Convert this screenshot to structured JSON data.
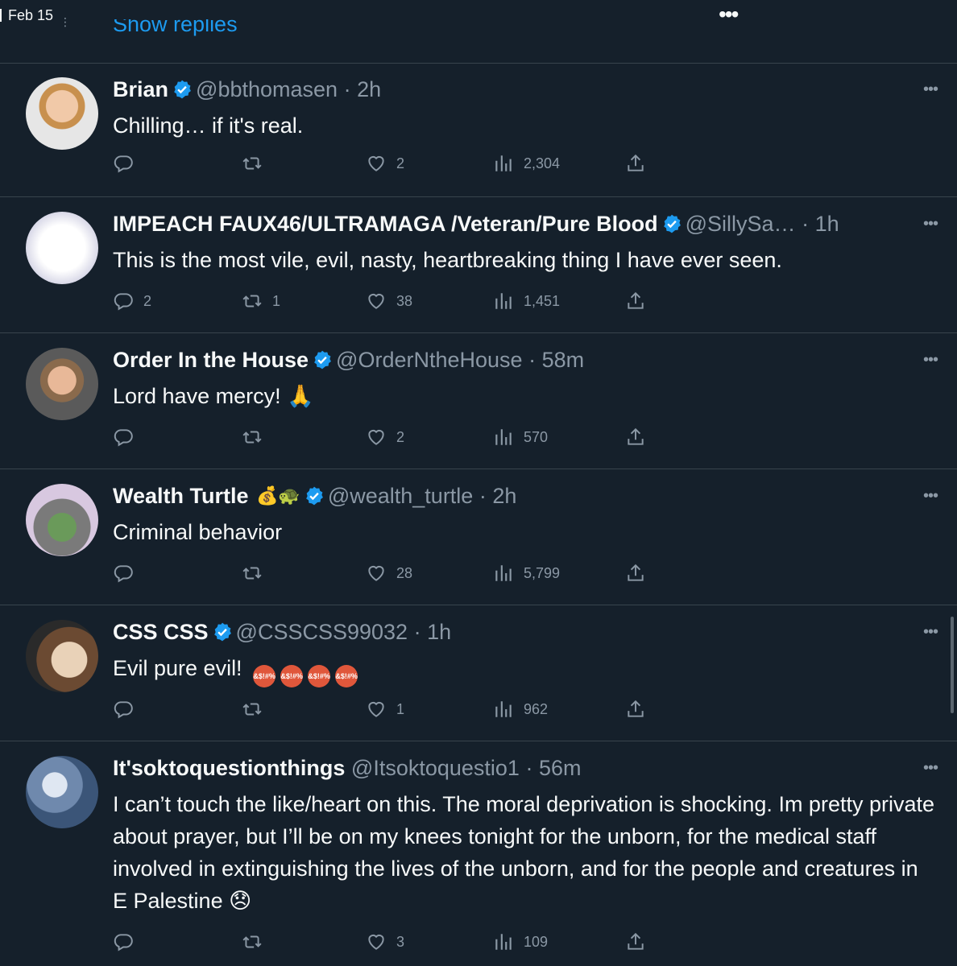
{
  "topbar": {
    "date": "Feb 15",
    "show_replies": "Show replies"
  },
  "colors": {
    "background": "#15202b",
    "accent": "#1d9bf0",
    "muted": "#8b98a5",
    "divider": "#38444d"
  },
  "tweets": [
    {
      "name": "Brian",
      "handle": "@bbthomasen",
      "time": "2h",
      "sep": "·",
      "text": "Chilling… if it's real.",
      "replies": "",
      "retweets": "",
      "likes": "2",
      "views": "2,304",
      "emoji": ""
    },
    {
      "name": "IMPEACH FAUX46/ULTRAMAGA /Veteran/Pure Blood",
      "handle": "@SillySa…",
      "time": "1h",
      "sep": "·",
      "text": "This is the most vile, evil, nasty, heartbreaking thing I have ever seen.",
      "replies": "2",
      "retweets": "1",
      "likes": "38",
      "views": "1,451",
      "emoji": ""
    },
    {
      "name": "Order In the House",
      "handle": "@OrderNtheHouse",
      "time": "58m",
      "sep": "·",
      "text": "Lord have mercy! 🙏",
      "replies": "",
      "retweets": "",
      "likes": "2",
      "views": "570",
      "emoji": ""
    },
    {
      "name": "Wealth Turtle",
      "handle": "@wealth_turtle",
      "time": "2h",
      "sep": "·",
      "text": "Criminal behavior",
      "replies": "",
      "retweets": "",
      "likes": "28",
      "views": "5,799",
      "emoji": "💰🐢"
    },
    {
      "name": "CSS CSS",
      "handle": "@CSSCSS99032",
      "time": "1h",
      "sep": "·",
      "text": "Evil pure evil!",
      "replies": "",
      "retweets": "",
      "likes": "1",
      "views": "962",
      "emoji": ""
    },
    {
      "name": "It'soktoquestionthings",
      "handle": "@Itsoktoquestio1",
      "time": "56m",
      "sep": "·",
      "text": "I can’t touch the like/heart on this. The moral deprivation is shocking. Im pretty private about prayer, but I’ll be on my knees tonight for the unborn, for the medical staff involved in extinguishing the lives of the unborn, and for the people and creatures in E Palestine 😞",
      "replies": "",
      "retweets": "",
      "likes": "3",
      "views": "109",
      "emoji": ""
    }
  ],
  "icons": {
    "more": "more-horizontal-icon",
    "verified": "verified-badge-icon",
    "reply": "reply-icon",
    "retweet": "retweet-icon",
    "like": "heart-icon",
    "views": "views-icon",
    "share": "share-icon"
  },
  "css_emoji_label": "&$!#%"
}
